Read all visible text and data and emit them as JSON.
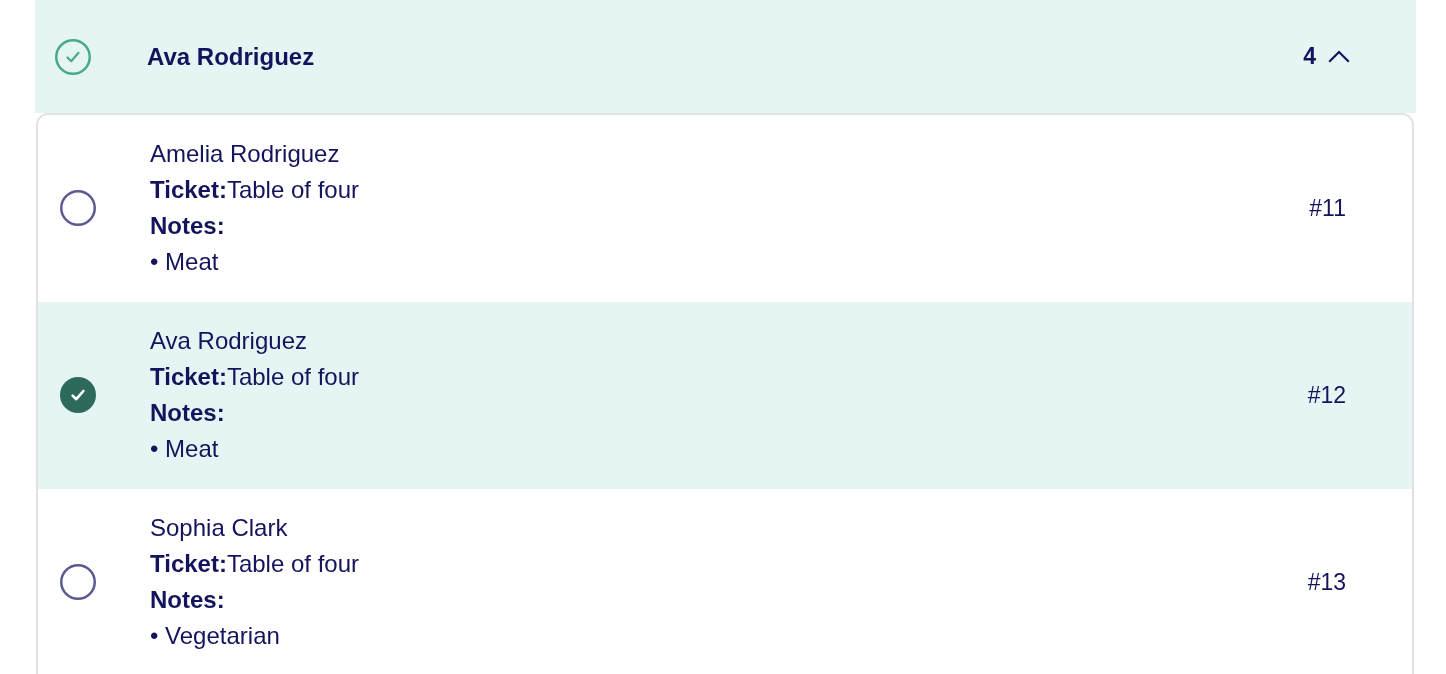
{
  "group": {
    "name": "Ava Rodriguez",
    "checked": true,
    "count": "4",
    "expanded": true
  },
  "entries": [
    {
      "name": "Amelia Rodriguez",
      "ticket": "**Ticket:**Table of four",
      "notes_label": "Notes:",
      "notes": [
        "• Meat"
      ],
      "number": "#11",
      "selected": false
    },
    {
      "name": "Ava Rodriguez",
      "ticket": "**Ticket:**Table of four",
      "notes_label": "Notes:",
      "notes": [
        "• Meat"
      ],
      "number": "#12",
      "selected": true
    },
    {
      "name": "Sophia Clark",
      "ticket": "**Ticket:**Table of four",
      "notes_label": "Notes:",
      "notes": [
        "• Vegetarian"
      ],
      "number": "#13",
      "selected": false
    }
  ]
}
